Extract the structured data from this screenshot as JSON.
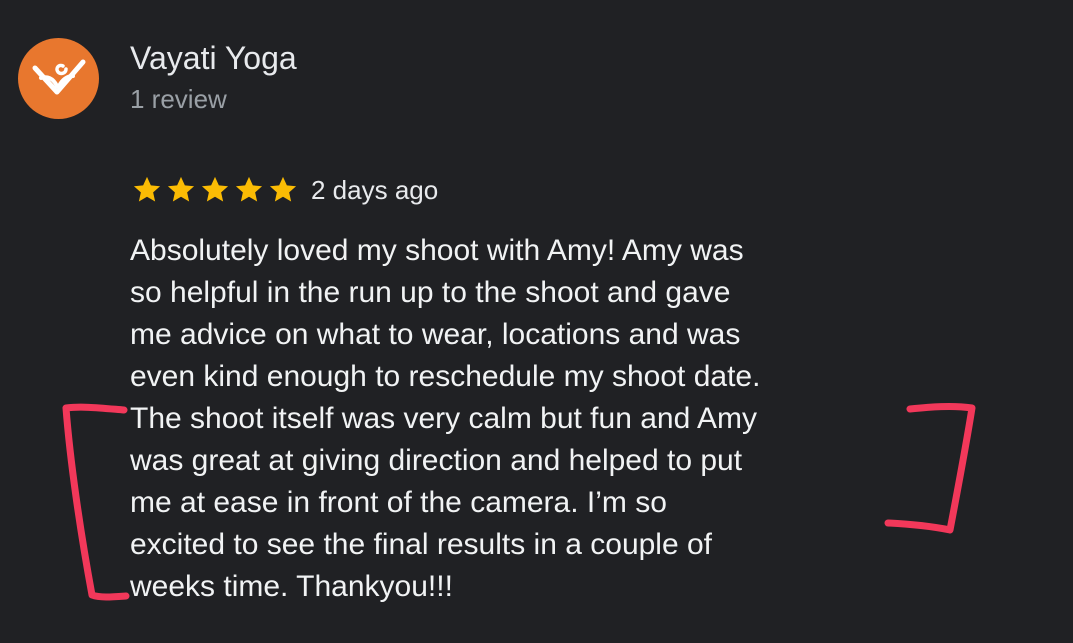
{
  "reviewer": {
    "name": "Vayati Yoga",
    "review_count": "1 review",
    "avatar_color": "#e8772e",
    "avatar_icon": "yoga-lotus-logo-icon"
  },
  "review": {
    "rating": 5,
    "max_rating": 5,
    "star_color": "#fbbc04",
    "time": "2 days ago",
    "lines": [
      "Absolutely loved my shoot with Amy! Amy was",
      "so helpful in the run up to the shoot and gave",
      "me advice on what to wear, locations and was",
      "even kind enough to reschedule my shoot date.",
      "The shoot itself was very calm but fun and Amy",
      "was great at giving direction and helped to put",
      "me at ease in front of the camera. I’m so",
      "excited to see the final results in a couple of",
      "weeks time. Thankyou!!!"
    ]
  },
  "annotation": {
    "color": "#f2385a",
    "type": "hand-drawn-brackets"
  }
}
